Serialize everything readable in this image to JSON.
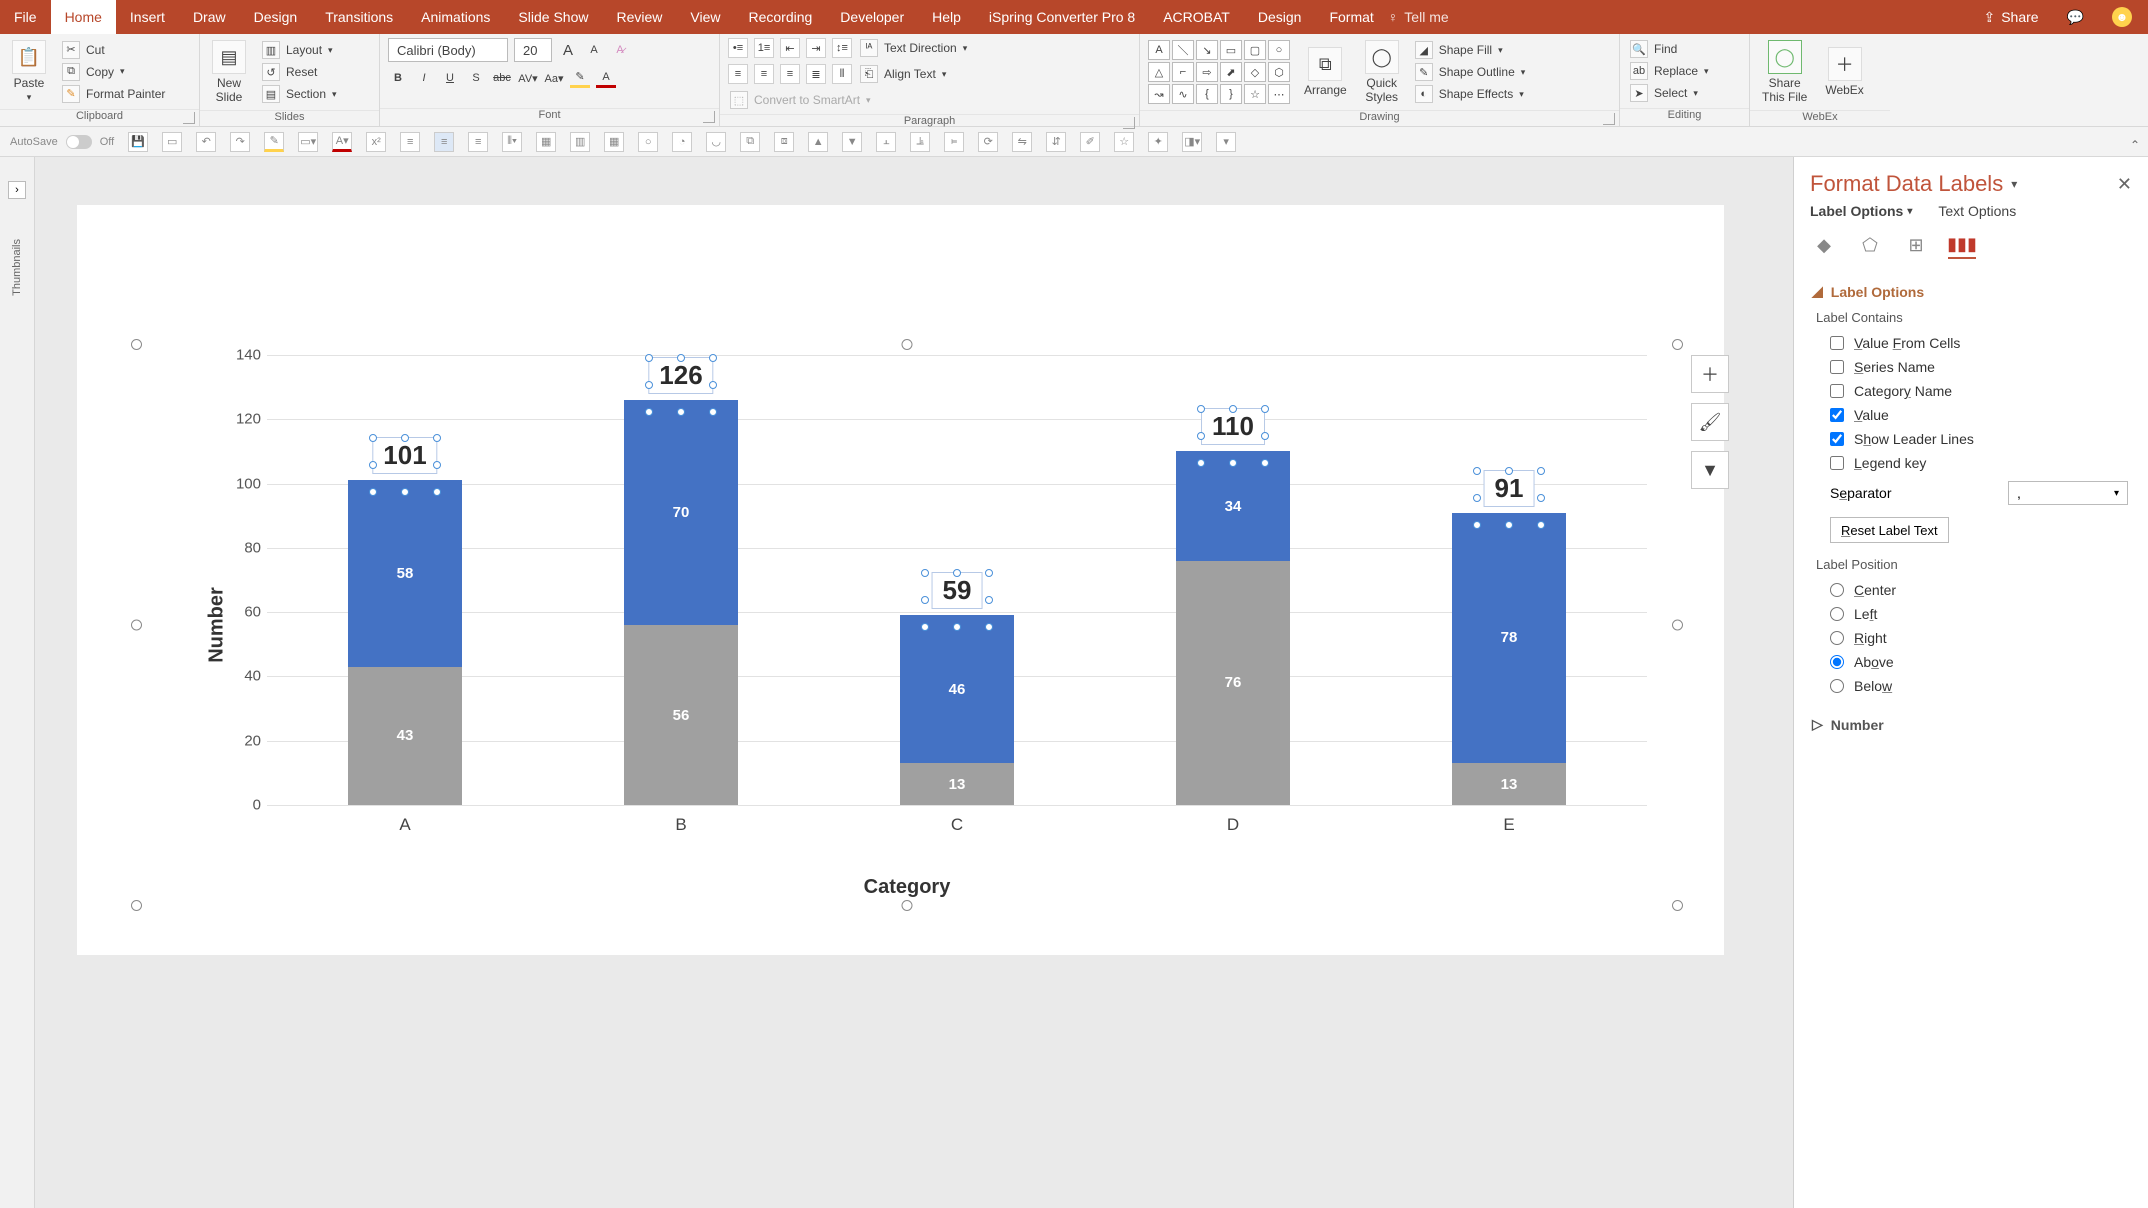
{
  "tabs": [
    "File",
    "Home",
    "Insert",
    "Draw",
    "Design",
    "Transitions",
    "Animations",
    "Slide Show",
    "Review",
    "View",
    "Recording",
    "Developer",
    "Help",
    "iSpring Converter Pro 8",
    "ACROBAT",
    "Design",
    "Format"
  ],
  "active_tab": "Home",
  "tell_me": "Tell me",
  "share_label": "Share",
  "ribbon": {
    "clipboard": {
      "group": "Clipboard",
      "paste": "Paste",
      "cut": "Cut",
      "copy": "Copy",
      "fmtpaint": "Format Painter"
    },
    "slides": {
      "group": "Slides",
      "newslide": "New\nSlide",
      "layout": "Layout",
      "reset": "Reset",
      "section": "Section"
    },
    "font": {
      "group": "Font",
      "name": "Calibri (Body)",
      "size": "20"
    },
    "paragraph": {
      "group": "Paragraph",
      "textdir": "Text Direction",
      "align": "Align Text",
      "smartart": "Convert to SmartArt"
    },
    "drawing": {
      "group": "Drawing",
      "arrange": "Arrange",
      "quick": "Quick\nStyles",
      "fill": "Shape Fill",
      "outline": "Shape Outline",
      "effects": "Shape Effects"
    },
    "editing": {
      "group": "Editing",
      "find": "Find",
      "replace": "Replace",
      "select": "Select"
    },
    "webex": {
      "group": "WebEx",
      "share": "Share\nThis File",
      "webex": "WebEx"
    }
  },
  "qat": {
    "autosave": "AutoSave",
    "autoswitch": "Off"
  },
  "thumb_label": "Thumbnails",
  "chart_data": {
    "type": "bar",
    "stacked": true,
    "categories": [
      "A",
      "B",
      "C",
      "D",
      "E"
    ],
    "series": [
      {
        "name": "grey",
        "values": [
          43,
          56,
          13,
          76,
          13
        ]
      },
      {
        "name": "blue",
        "values": [
          58,
          70,
          46,
          34,
          78
        ]
      }
    ],
    "totals": [
      101,
      126,
      59,
      110,
      91
    ],
    "xlabel": "Category",
    "ylabel": "Number",
    "yticks": [
      0,
      20,
      40,
      60,
      80,
      100,
      120,
      140
    ],
    "ylim": [
      0,
      140
    ]
  },
  "panel": {
    "title": "Format Data Labels",
    "tab_label": "Label Options",
    "tab_text": "Text Options",
    "sect_labelopts": "Label Options",
    "contains_head": "Label Contains",
    "chk_valuefrom": "Value From Cells",
    "chk_series": "Series Name",
    "chk_category": "Category Name",
    "chk_value": "Value",
    "chk_leader": "Show Leader Lines",
    "chk_legend": "Legend key",
    "sep_label": "Separator",
    "sep_value": ",",
    "reset": "Reset Label Text",
    "pos_head": "Label Position",
    "rad_center": "Center",
    "rad_left": "Left",
    "rad_right": "Right",
    "rad_above": "Above",
    "rad_below": "Below",
    "sect_number": "Number"
  }
}
